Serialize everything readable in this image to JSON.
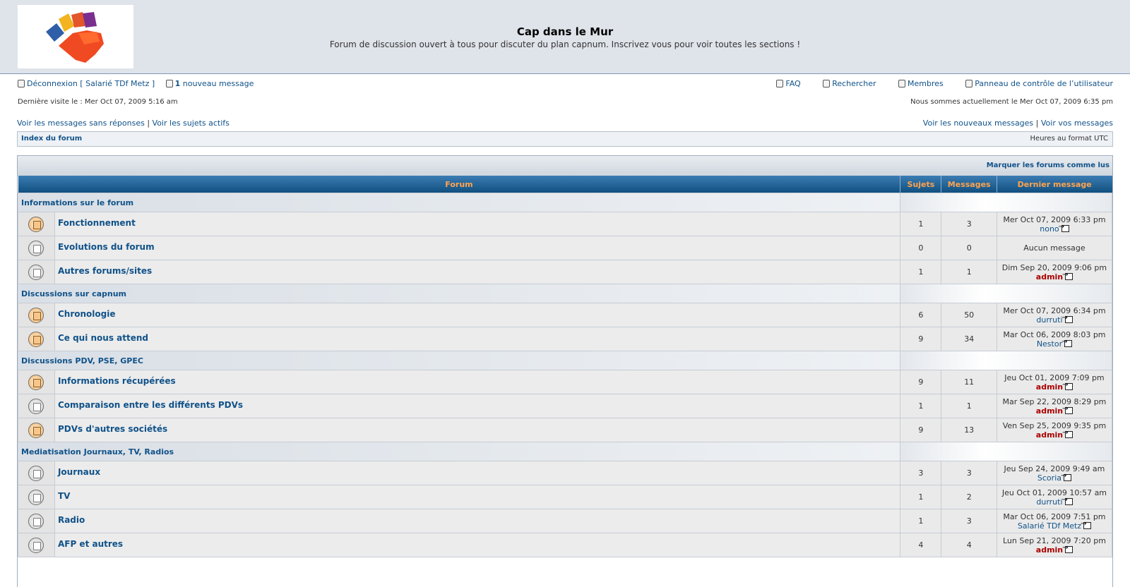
{
  "header": {
    "title": "Cap dans le Mur",
    "description": "Forum de discussion ouvert à tous pour discuter du plan capnum. Inscrivez vous pour voir toutes les sections !"
  },
  "userbar": {
    "logout": "Déconnexion [ Salarié TDf Metz ]",
    "new_count": "1",
    "new_label": " nouveau message",
    "faq": "FAQ",
    "search": "Rechercher",
    "members": "Membres",
    "ucp": "Panneau de contrôle de l’utilisateur"
  },
  "visit": {
    "last_visit": "Dernière visite le : Mer Oct 07, 2009 5:16 am",
    "current_time": "Nous sommes actuellement le Mer Oct 07, 2009 6:35 pm"
  },
  "searchlinks": {
    "unanswered": "Voir les messages sans réponses",
    "active": "Voir les sujets actifs",
    "sep": " | ",
    "new_posts": "Voir les nouveaux messages",
    "your_posts": "Voir vos messages"
  },
  "navbar": {
    "index": "Index du forum",
    "timezone": "Heures au format UTC"
  },
  "mark_read": "Marquer les forums comme lus",
  "columns": {
    "forum": "Forum",
    "topics": "Sujets",
    "posts": "Messages",
    "last_post": "Dernier message"
  },
  "categories": [
    {
      "name": "Informations sur le forum",
      "forums": [
        {
          "name": "Fonctionnement",
          "unread": true,
          "topics": "1",
          "posts": "3",
          "last_date": "Mer Oct 07, 2009 6:33 pm",
          "last_author": "nono",
          "admin": false
        },
        {
          "name": "Evolutions du forum",
          "unread": false,
          "topics": "0",
          "posts": "0",
          "last_date": "Aucun message",
          "last_author": "",
          "admin": false
        },
        {
          "name": "Autres forums/sites",
          "unread": false,
          "topics": "1",
          "posts": "1",
          "last_date": "Dim Sep 20, 2009 9:06 pm",
          "last_author": "admin",
          "admin": true
        }
      ]
    },
    {
      "name": "Discussions sur capnum",
      "forums": [
        {
          "name": "Chronologie",
          "unread": true,
          "topics": "6",
          "posts": "50",
          "last_date": "Mer Oct 07, 2009 6:34 pm",
          "last_author": "durruti",
          "admin": false
        },
        {
          "name": "Ce qui nous attend",
          "unread": true,
          "topics": "9",
          "posts": "34",
          "last_date": "Mar Oct 06, 2009 8:03 pm",
          "last_author": "Nestor",
          "admin": false
        }
      ]
    },
    {
      "name": "Discussions PDV, PSE, GPEC",
      "forums": [
        {
          "name": "Informations récupérées",
          "unread": true,
          "topics": "9",
          "posts": "11",
          "last_date": "Jeu Oct 01, 2009 7:09 pm",
          "last_author": "admin",
          "admin": true
        },
        {
          "name": "Comparaison entre les différents PDVs",
          "unread": false,
          "topics": "1",
          "posts": "1",
          "last_date": "Mar Sep 22, 2009 8:29 pm",
          "last_author": "admin",
          "admin": true
        },
        {
          "name": "PDVs d'autres sociétés",
          "unread": true,
          "topics": "9",
          "posts": "13",
          "last_date": "Ven Sep 25, 2009 9:35 pm",
          "last_author": "admin",
          "admin": true
        }
      ]
    },
    {
      "name": "Mediatisation Journaux, TV, Radios",
      "forums": [
        {
          "name": "Journaux",
          "unread": false,
          "topics": "3",
          "posts": "3",
          "last_date": "Jeu Sep 24, 2009 9:49 am",
          "last_author": "Scoria",
          "admin": false
        },
        {
          "name": "TV",
          "unread": false,
          "topics": "1",
          "posts": "2",
          "last_date": "Jeu Oct 01, 2009 10:57 am",
          "last_author": "durruti",
          "admin": false
        },
        {
          "name": "Radio",
          "unread": false,
          "topics": "1",
          "posts": "3",
          "last_date": "Mar Oct 06, 2009 7:51 pm",
          "last_author": "Salarié TDf Metz",
          "admin": false
        },
        {
          "name": "AFP et autres",
          "unread": false,
          "topics": "4",
          "posts": "4",
          "last_date": "Lun Sep 21, 2009 7:20 pm",
          "last_author": "admin",
          "admin": true
        }
      ]
    }
  ]
}
